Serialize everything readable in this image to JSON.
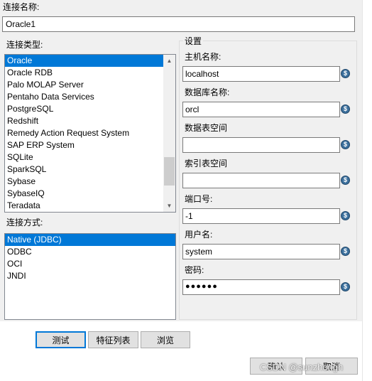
{
  "connection_name": {
    "label": "连接名称:",
    "value": "Oracle1"
  },
  "connection_type": {
    "label": "连接类型:",
    "items": [
      "Oracle",
      "Oracle RDB",
      "Palo MOLAP Server",
      "Pentaho Data Services",
      "PostgreSQL",
      "Redshift",
      "Remedy Action Request System",
      "SAP ERP System",
      "SQLite",
      "SparkSQL",
      "Sybase",
      "SybaseIQ",
      "Teradata"
    ],
    "selected": "Oracle"
  },
  "access_method": {
    "label": "连接方式:",
    "items": [
      "Native (JDBC)",
      "ODBC",
      "OCI",
      "JNDI"
    ],
    "selected": "Native (JDBC)"
  },
  "settings": {
    "title": "设置",
    "host": {
      "label": "主机名称:",
      "value": "localhost"
    },
    "database": {
      "label": "数据库名称:",
      "value": "orcl"
    },
    "data_tablespace": {
      "label": "数据表空间",
      "value": ""
    },
    "index_tablespace": {
      "label": "索引表空间",
      "value": ""
    },
    "port": {
      "label": "端口号:",
      "value": "-1"
    },
    "username": {
      "label": "用户名:",
      "value": "system"
    },
    "password": {
      "label": "密码:",
      "value": "●●●●●●"
    },
    "variable_icon": "variable-dollar-icon"
  },
  "buttons": {
    "test": "测试",
    "features": "特征列表",
    "browse": "浏览",
    "ok": "确认",
    "cancel": "取消"
  },
  "watermark": "CSDN @sunzhongh",
  "colors": {
    "selection": "#0078d7",
    "panel": "#f0f0f0",
    "default_button_border": "#0078d7"
  }
}
